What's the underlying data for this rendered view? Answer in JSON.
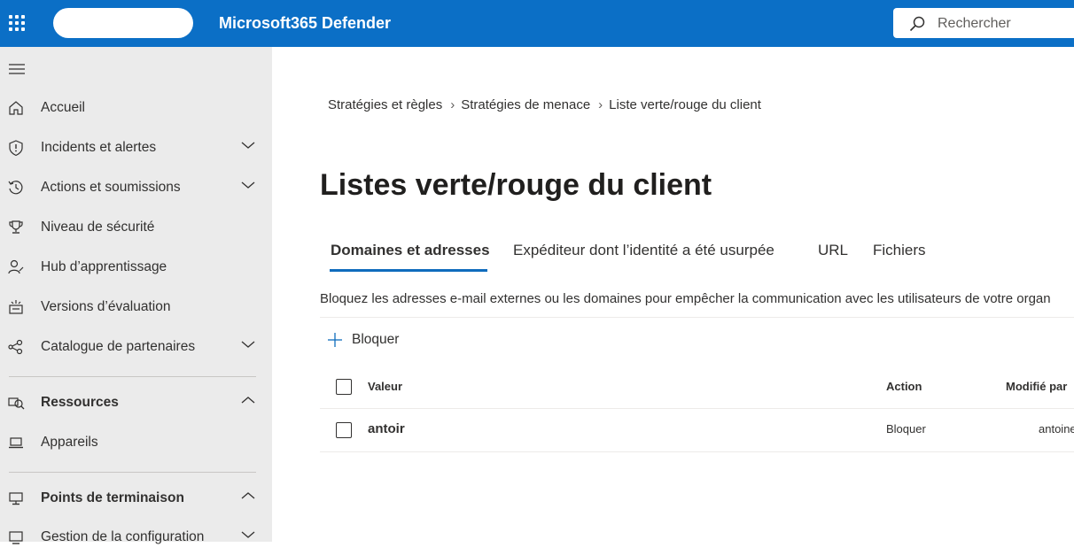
{
  "header": {
    "app_title": "Microsoft365 Defender",
    "search_placeholder": "Rechercher",
    "brand_color": "#0b6fc6"
  },
  "sidebar": {
    "items": [
      {
        "label": "Accueil",
        "icon": "home-icon",
        "chevron": "none"
      },
      {
        "label": "Incidents et alertes",
        "icon": "shield-icon",
        "chevron": "down"
      },
      {
        "label": "Actions et soumissions",
        "icon": "history-icon",
        "chevron": "down"
      },
      {
        "label": "Niveau de sécurité",
        "icon": "trophy-icon",
        "chevron": "none"
      },
      {
        "label": "Hub d’apprentissage",
        "icon": "learning-icon",
        "chevron": "none"
      },
      {
        "label": "Versions d’évaluation",
        "icon": "evaluation-icon",
        "chevron": "none"
      },
      {
        "label": "Catalogue de partenaires",
        "icon": "partners-icon",
        "chevron": "down"
      }
    ],
    "sections": [
      {
        "label": "Ressources",
        "icon": "assets-icon",
        "chevron": "up",
        "items": [
          {
            "label": "Appareils",
            "icon": "laptop-icon"
          }
        ]
      },
      {
        "label": "Points de terminaison",
        "icon": "endpoints-icon",
        "chevron": "up",
        "items": [
          {
            "label": "Gestion de la configuration",
            "icon": "config-icon",
            "chevron": "down"
          }
        ]
      }
    ]
  },
  "breadcrumb": [
    "Stratégies et règles",
    "Stratégies de menace",
    "Liste verte/rouge du client"
  ],
  "page_title": "Listes verte/rouge du client",
  "tabs": [
    {
      "label": "Domaines et adresses",
      "active": true
    },
    {
      "label": "Expéditeur dont l’identité a été usurpée",
      "active": false
    },
    {
      "label": "URL",
      "active": false
    },
    {
      "label": "Fichiers",
      "active": false
    }
  ],
  "description": "Bloquez les adresses e-mail externes ou les domaines pour empêcher la communication avec les utilisateurs de votre organ",
  "toolbar": {
    "block_label": "Bloquer"
  },
  "table": {
    "columns": [
      "Valeur",
      "Action",
      "Modifié par"
    ],
    "rows": [
      {
        "value": "antoir",
        "action": "Bloquer",
        "modified_by": "antoine"
      }
    ]
  }
}
